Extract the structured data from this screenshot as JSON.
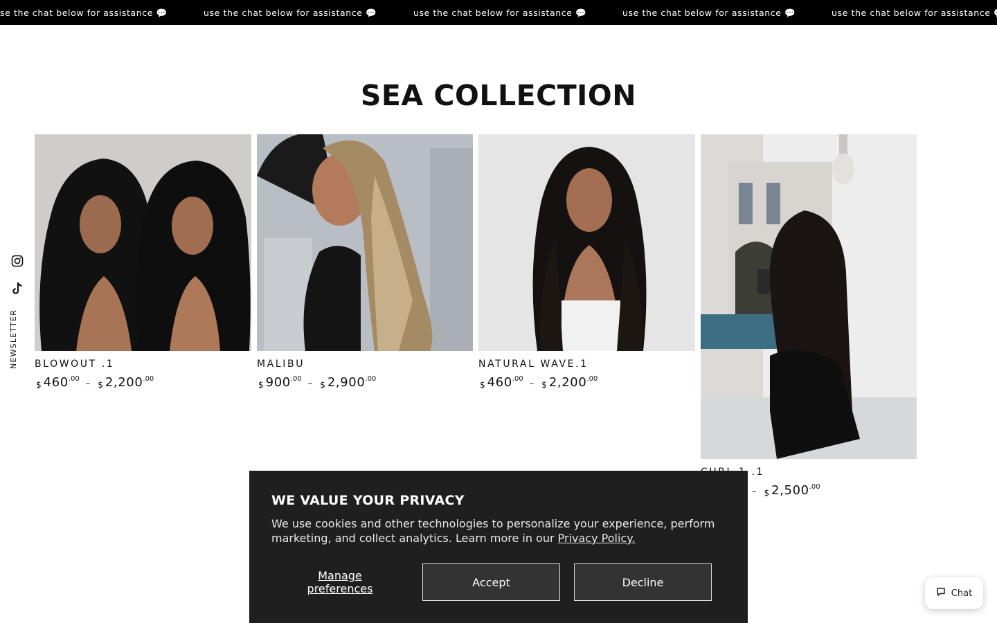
{
  "announcement": {
    "messages": [
      "se the chat below for assistance 💬",
      "use the chat below for assistance 💬",
      "use the chat below for assistance 💬",
      "use the chat below for assistance 💬",
      "use the chat below for assistance 💬"
    ]
  },
  "collection": {
    "title": "SEA COLLECTION"
  },
  "side_rail": {
    "icons": [
      "instagram-icon",
      "tiktok-icon"
    ],
    "newsletter_label": "NEWSLETTER"
  },
  "products": [
    {
      "name": "BLOWOUT .1",
      "currency": "$",
      "min_price": "460",
      "min_cents": ".00",
      "max_price": "2,200",
      "max_cents": ".00",
      "dash": "–"
    },
    {
      "name": "MALIBU",
      "currency": "$",
      "min_price": "900",
      "min_cents": ".00",
      "max_price": "2,900",
      "max_cents": ".00",
      "dash": "–"
    },
    {
      "name": "NATURAL WAVE.1",
      "currency": "$",
      "min_price": "460",
      "min_cents": ".00",
      "max_price": "2,200",
      "max_cents": ".00",
      "dash": "–"
    },
    {
      "name": "CURL 1 .1",
      "currency": "$",
      "max_price": "2,500",
      "max_cents": ".00",
      "dash": "–"
    }
  ],
  "cookie_banner": {
    "title": "WE VALUE YOUR PRIVACY",
    "body": "We use cookies and other technologies to personalize your experience, perform marketing, and collect analytics. Learn more in our ",
    "policy_link": "Privacy Policy.",
    "manage_label": "Manage preferences",
    "accept_label": "Accept",
    "decline_label": "Decline",
    "background": "#1f1f1f"
  },
  "chat": {
    "label": "Chat",
    "icon": "chat-bubble-icon"
  }
}
